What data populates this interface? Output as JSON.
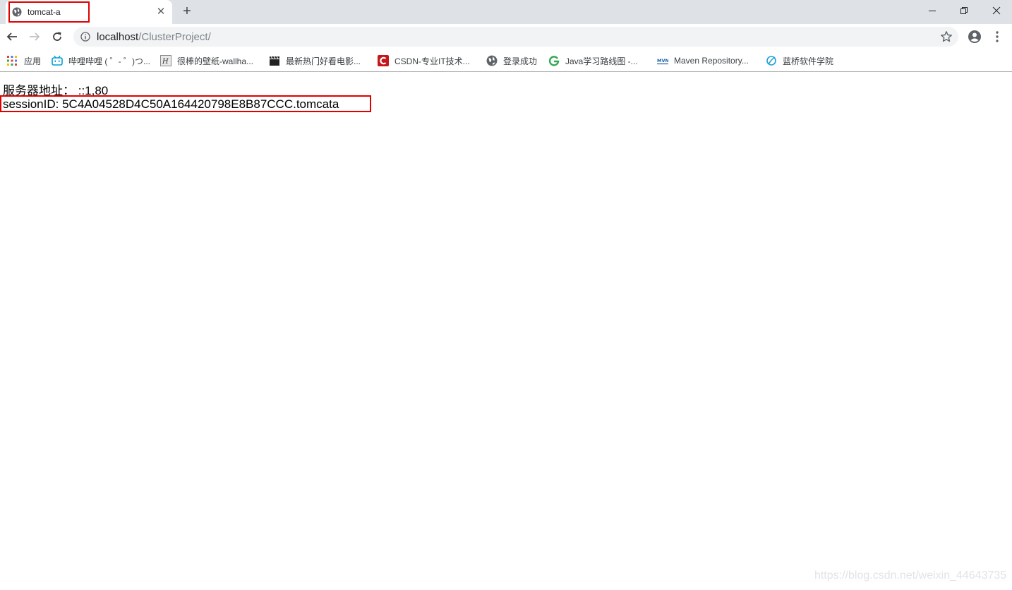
{
  "tab": {
    "title": "tomcat-a"
  },
  "toolbar": {
    "url_host": "localhost",
    "url_path": "/ClusterProject/"
  },
  "bookmarks": [
    {
      "label": "应用",
      "icon": "apps-grid-icon"
    },
    {
      "label": "哔哩哔哩 ( ゜- ゜)つ...",
      "icon": "bilibili-icon"
    },
    {
      "label": "很棒的壁纸-wallha...",
      "icon": "wallhaven-icon"
    },
    {
      "label": "最新热门好看电影...",
      "icon": "clapperboard-icon"
    },
    {
      "label": "CSDN-专业IT技术...",
      "icon": "csdn-icon"
    },
    {
      "label": "登录成功",
      "icon": "globe-icon"
    },
    {
      "label": "Java学习路线图 -...",
      "icon": "g-logo-icon"
    },
    {
      "label": "Maven Repository...",
      "icon": "mvn-icon"
    },
    {
      "label": "蓝桥软件学院",
      "icon": "lanqiao-icon"
    }
  ],
  "page": {
    "server_address": "服务器地址： ::1,80",
    "session_id": "sessionID: 5C4A04528D4C50A164420798E8B87CCC.tomcata"
  },
  "watermark": "https://blog.csdn.net/weixin_44643735",
  "colors": {
    "highlight": "#e00000",
    "tabstrip": "#dee1e6",
    "omnibox": "#f1f3f4"
  }
}
